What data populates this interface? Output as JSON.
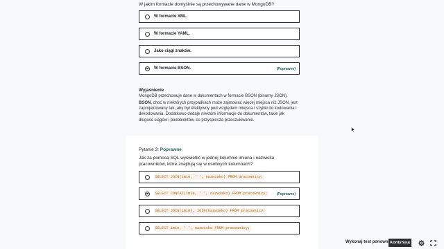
{
  "question2": {
    "text": "W jakim formacie domyślnie są przechowywane dane w MongoDB?",
    "options": [
      {
        "label": "W formacie XML.",
        "selected": false,
        "correct": false
      },
      {
        "label": "W formacie YAML.",
        "selected": false,
        "correct": false
      },
      {
        "label": "Jako ciągi znaków.",
        "selected": false,
        "correct": false
      },
      {
        "label": "W formacie BSON.",
        "selected": true,
        "correct": true
      }
    ],
    "correct_tag": "(Poprawne)"
  },
  "explanation": {
    "title": "Wyjaśnienie",
    "line1": "MongoDB przechowuje dane w dokumentach w formacie BSON (binarny JSON).",
    "bold_word": "BSON",
    "body": ", choć w niektórych przypadkach może zajmować więcej miejsca niż JSON, jest zaprojektowany tak, aby był efektywny pod względem miejsca i szybki do kodowania i dekodowania. Dodatkowo dodaje niektóre informacje do dokumentów, takie jak długość ciągów i podobiektów, co przyspiesza przeszukiwanie."
  },
  "question3": {
    "header": "Pytanie 3:",
    "status": "Poprawne",
    "text": "Jak za pomocą SQL wyświetlić w jednej kolumnie imiona i nazwiska pracowników, które znajdują się w osobnych kolumnach?",
    "options": [
      {
        "code": "SELECT JOIN(imie, ' ', nazwisko) FROM pracownicy;",
        "selected": false,
        "correct": false
      },
      {
        "code": "SELECT CONCAT(imie, ' ', nazwisko) FROM pracownicy;",
        "selected": true,
        "correct": true
      },
      {
        "code": "SELECT JOIN(imie), JOIN(nazwisko) FROM pracownicy;",
        "selected": false,
        "correct": false
      },
      {
        "code": "SELECT imie, ' ', nazwisko FROM pracownicy;",
        "selected": false,
        "correct": false
      }
    ],
    "correct_tag": "(Poprawne)"
  },
  "footer": {
    "retry_label": "Wykonaj test ponownie",
    "continue_label": "Kontynuuj"
  },
  "icons": {
    "settings": "gear-icon",
    "fullscreen": "expand-icon",
    "cursor": "mouse-cursor-icon"
  },
  "colors": {
    "correct_green": "#1e6055",
    "code_orange": "#b4690e",
    "dark": "#2d2f31"
  }
}
